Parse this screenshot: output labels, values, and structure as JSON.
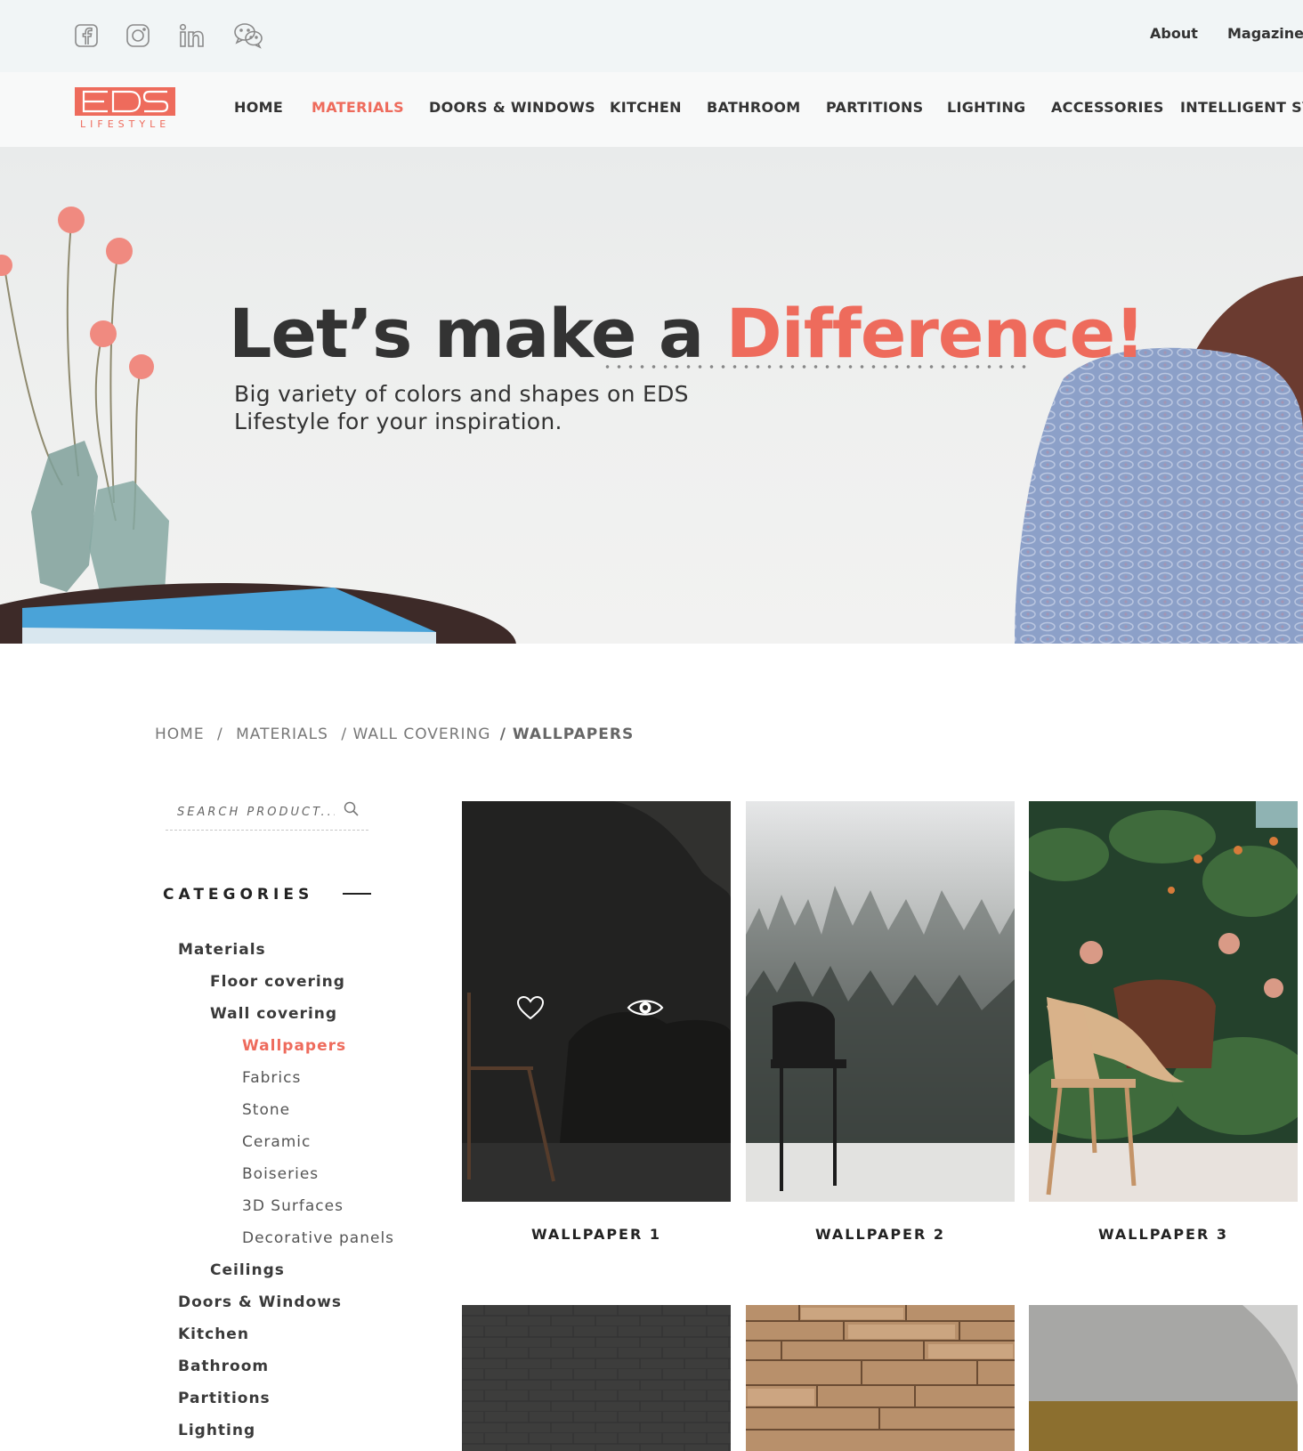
{
  "topbar": {
    "social": [
      "facebook-icon",
      "instagram-icon",
      "linkedin-icon",
      "wechat-icon"
    ],
    "links": [
      "About",
      "Magazine"
    ]
  },
  "logo": {
    "brand": "EDS",
    "tagline": "LIFESTYLE"
  },
  "nav": {
    "items": [
      "HOME",
      "MATERIALS",
      "DOORS & WINDOWS",
      "KITCHEN",
      "BATHROOM",
      "PARTITIONS",
      "LIGHTING",
      "ACCESSORIES",
      "INTELLIGENT SYS"
    ],
    "active": "MATERIALS"
  },
  "hero": {
    "headline_main": "Let’s make a ",
    "headline_accent": "Difference!",
    "subtitle": "Big variety of colors and shapes on EDS Lifestyle for your inspiration."
  },
  "breadcrumb": {
    "items": [
      "HOME",
      "/",
      "MATERIALS",
      "/ WALL COVERING",
      "/ WALLPAPERS"
    ]
  },
  "sidebar": {
    "search_placeholder": "SEARCH PRODUCT...",
    "categories_title": "CATEGORIES",
    "categories": [
      {
        "label": "Materials",
        "level": 1
      },
      {
        "label": "Floor covering",
        "level": 2
      },
      {
        "label": "Wall covering",
        "level": 2
      },
      {
        "label": "Wallpapers",
        "level": 3,
        "active": true
      },
      {
        "label": "Fabrics",
        "level": 3
      },
      {
        "label": "Stone",
        "level": 3
      },
      {
        "label": "Ceramic",
        "level": 3
      },
      {
        "label": "Boiseries",
        "level": 3
      },
      {
        "label": "3D Surfaces",
        "level": 3
      },
      {
        "label": "Decorative panels",
        "level": 3
      },
      {
        "label": "Ceilings",
        "level": 2
      },
      {
        "label": "Doors & Windows",
        "level": 1
      },
      {
        "label": "Kitchen",
        "level": 1
      },
      {
        "label": "Bathroom",
        "level": 1
      },
      {
        "label": "Partitions",
        "level": 1
      },
      {
        "label": "Lighting",
        "level": 1
      }
    ]
  },
  "products": [
    {
      "name": "WALLPAPER 1"
    },
    {
      "name": "WALLPAPER 2"
    },
    {
      "name": "WALLPAPER 3"
    }
  ],
  "colors": {
    "accent": "#ee6b5c",
    "text": "#333333",
    "topbar_bg": "#f1f5f6"
  }
}
